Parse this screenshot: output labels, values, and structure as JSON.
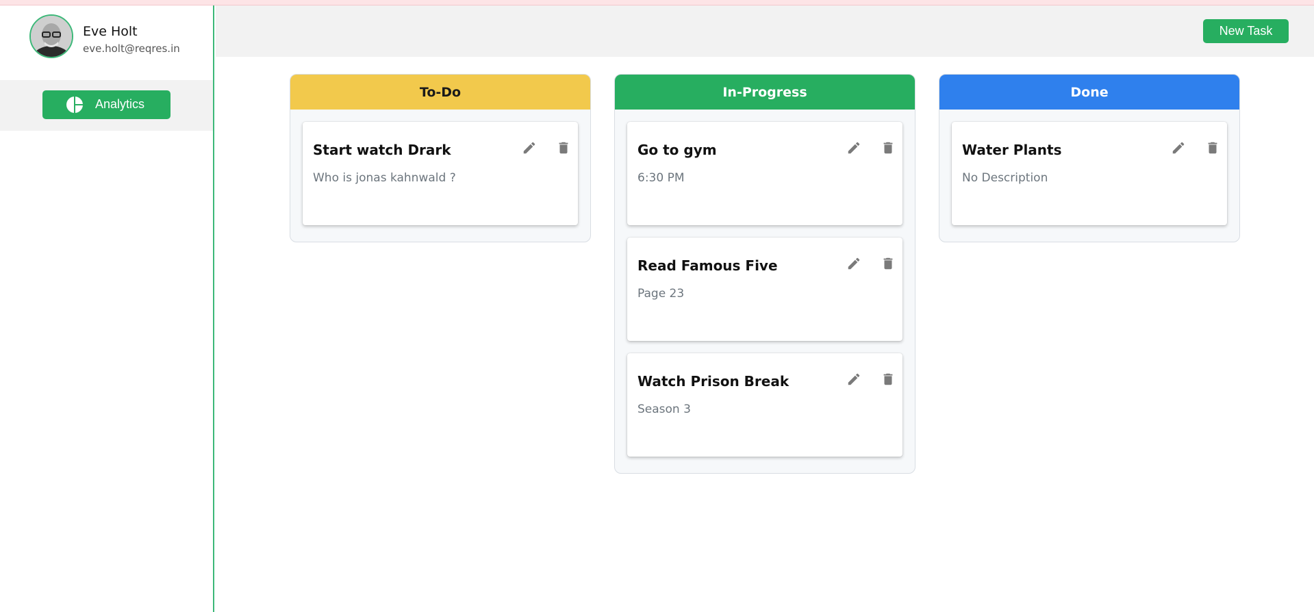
{
  "sidebar": {
    "user": {
      "name": "Eve Holt",
      "email": "eve.holt@reqres.in"
    },
    "nav": {
      "analytics_label": "Analytics",
      "icon": "pie-chart-icon"
    }
  },
  "header": {
    "new_task_label": "New Task"
  },
  "colors": {
    "accent": "#27ae60",
    "todo": "#f2c94c",
    "in_progress": "#27ae60",
    "done": "#2f80ed",
    "icon_gray": "#7a7a7a"
  },
  "columns": [
    {
      "title": "To-Do",
      "cards": [
        {
          "title": "Start watch Drark",
          "description": "Who is jonas kahnwald ?"
        }
      ]
    },
    {
      "title": "In-Progress",
      "cards": [
        {
          "title": "Go to gym",
          "description": "6:30 PM"
        },
        {
          "title": "Read Famous Five",
          "description": "Page 23"
        },
        {
          "title": "Watch Prison Break",
          "description": "Season 3"
        }
      ]
    },
    {
      "title": "Done",
      "cards": [
        {
          "title": "Water Plants",
          "description": "No Description"
        }
      ]
    }
  ]
}
